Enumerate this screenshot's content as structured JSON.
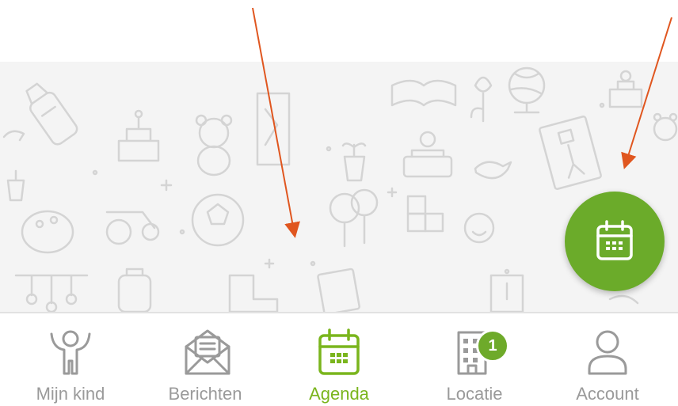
{
  "nav": {
    "items": [
      {
        "label": "Mijn kind",
        "icon": "child-icon",
        "active": false
      },
      {
        "label": "Berichten",
        "icon": "envelope-icon",
        "active": false
      },
      {
        "label": "Agenda",
        "icon": "calendar-icon",
        "active": true
      },
      {
        "label": "Locatie",
        "icon": "building-icon",
        "active": false,
        "badge": "1"
      },
      {
        "label": "Account",
        "icon": "person-icon",
        "active": false
      }
    ]
  },
  "fab": {
    "icon": "calendar-icon"
  },
  "colors": {
    "accent": "#6bab2a",
    "nav_inactive": "#9a9a9a",
    "arrow": "#e0561f",
    "pattern_bg": "#f4f4f4"
  }
}
